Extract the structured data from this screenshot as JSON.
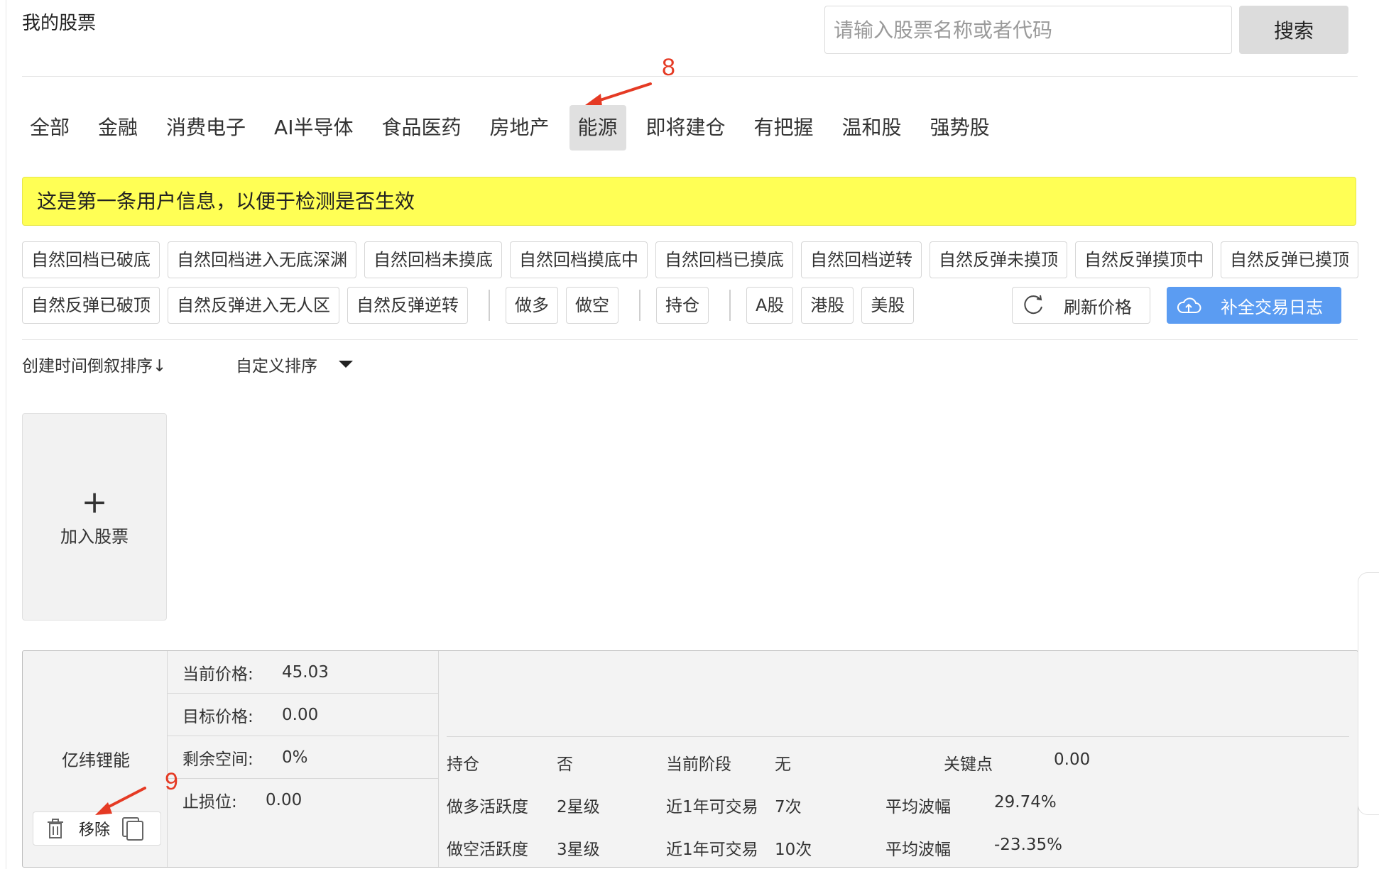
{
  "header": {
    "title": "我的股票",
    "search_placeholder": "请输入股票名称或者代码",
    "search_button": "搜索"
  },
  "category_tabs": [
    {
      "label": "全部",
      "active": false
    },
    {
      "label": "金融",
      "active": false
    },
    {
      "label": "消费电子",
      "active": false
    },
    {
      "label": "AI半导体",
      "active": false
    },
    {
      "label": "食品医药",
      "active": false
    },
    {
      "label": "房地产",
      "active": false
    },
    {
      "label": "能源",
      "active": true
    },
    {
      "label": "即将建仓",
      "active": false
    },
    {
      "label": "有把握",
      "active": false
    },
    {
      "label": "温和股",
      "active": false
    },
    {
      "label": "强势股",
      "active": false
    }
  ],
  "annotations": {
    "tab_marker": "8",
    "remove_marker": "9",
    "color": "#e53a24"
  },
  "notice": {
    "text": "这是第一条用户信息，以便于检测是否生效",
    "background": "#ffff55"
  },
  "filters": {
    "row1": [
      "自然回档已破底",
      "自然回档进入无底深渊",
      "自然回档未摸底",
      "自然回档摸底中",
      "自然回档已摸底",
      "自然回档逆转",
      "自然反弹未摸顶",
      "自然反弹摸顶中",
      "自然反弹已摸顶"
    ],
    "row2_states": [
      "自然反弹已破顶",
      "自然反弹进入无人区",
      "自然反弹逆转"
    ],
    "direction": [
      "做多",
      "做空"
    ],
    "position": [
      "持仓"
    ],
    "markets": [
      "A股",
      "港股",
      "美股"
    ],
    "refresh_label": "刷新价格",
    "journal_label": "补全交易日志",
    "journal_color": "#5b9cf2"
  },
  "sort": {
    "time_label": "创建时间倒叙排序↓",
    "custom_label": "自定义排序"
  },
  "add_card": {
    "plus": "+",
    "label": "加入股票"
  },
  "stock": {
    "name": "亿纬锂能",
    "remove_label": "移除",
    "prices": [
      {
        "label": "当前价格:",
        "value": "45.03"
      },
      {
        "label": "目标价格:",
        "value": "0.00"
      },
      {
        "label": "剩余空间:",
        "value": "0%"
      },
      {
        "label": "止损位:",
        "value": "0.00"
      }
    ],
    "info_rows": [
      [
        "持仓",
        "否",
        "当前阶段",
        "无",
        "关键点",
        "0.00"
      ],
      [
        "做多活跃度",
        "2星级",
        "近1年可交易",
        "7次",
        "平均波幅",
        "29.74%"
      ],
      [
        "做空活跃度",
        "3星级",
        "近1年可交易",
        "10次",
        "平均波幅",
        "-23.35%"
      ]
    ]
  }
}
